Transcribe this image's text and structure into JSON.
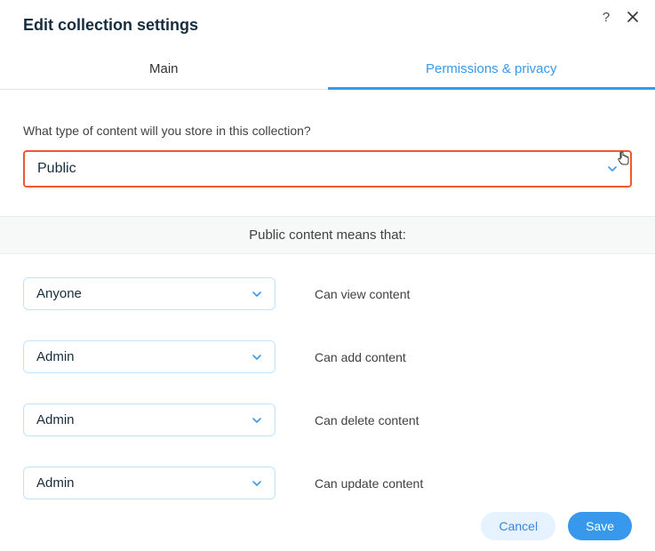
{
  "header": {
    "title": "Edit collection settings"
  },
  "tabs": {
    "main": "Main",
    "permissions": "Permissions & privacy"
  },
  "question": "What type of content will you store in this collection?",
  "content_type_select": {
    "value": "Public"
  },
  "banner": "Public content means that:",
  "permissions": [
    {
      "role": "Anyone",
      "label": "Can view content"
    },
    {
      "role": "Admin",
      "label": "Can add content"
    },
    {
      "role": "Admin",
      "label": "Can delete content"
    },
    {
      "role": "Admin",
      "label": "Can update content"
    }
  ],
  "footer": {
    "cancel": "Cancel",
    "save": "Save"
  }
}
